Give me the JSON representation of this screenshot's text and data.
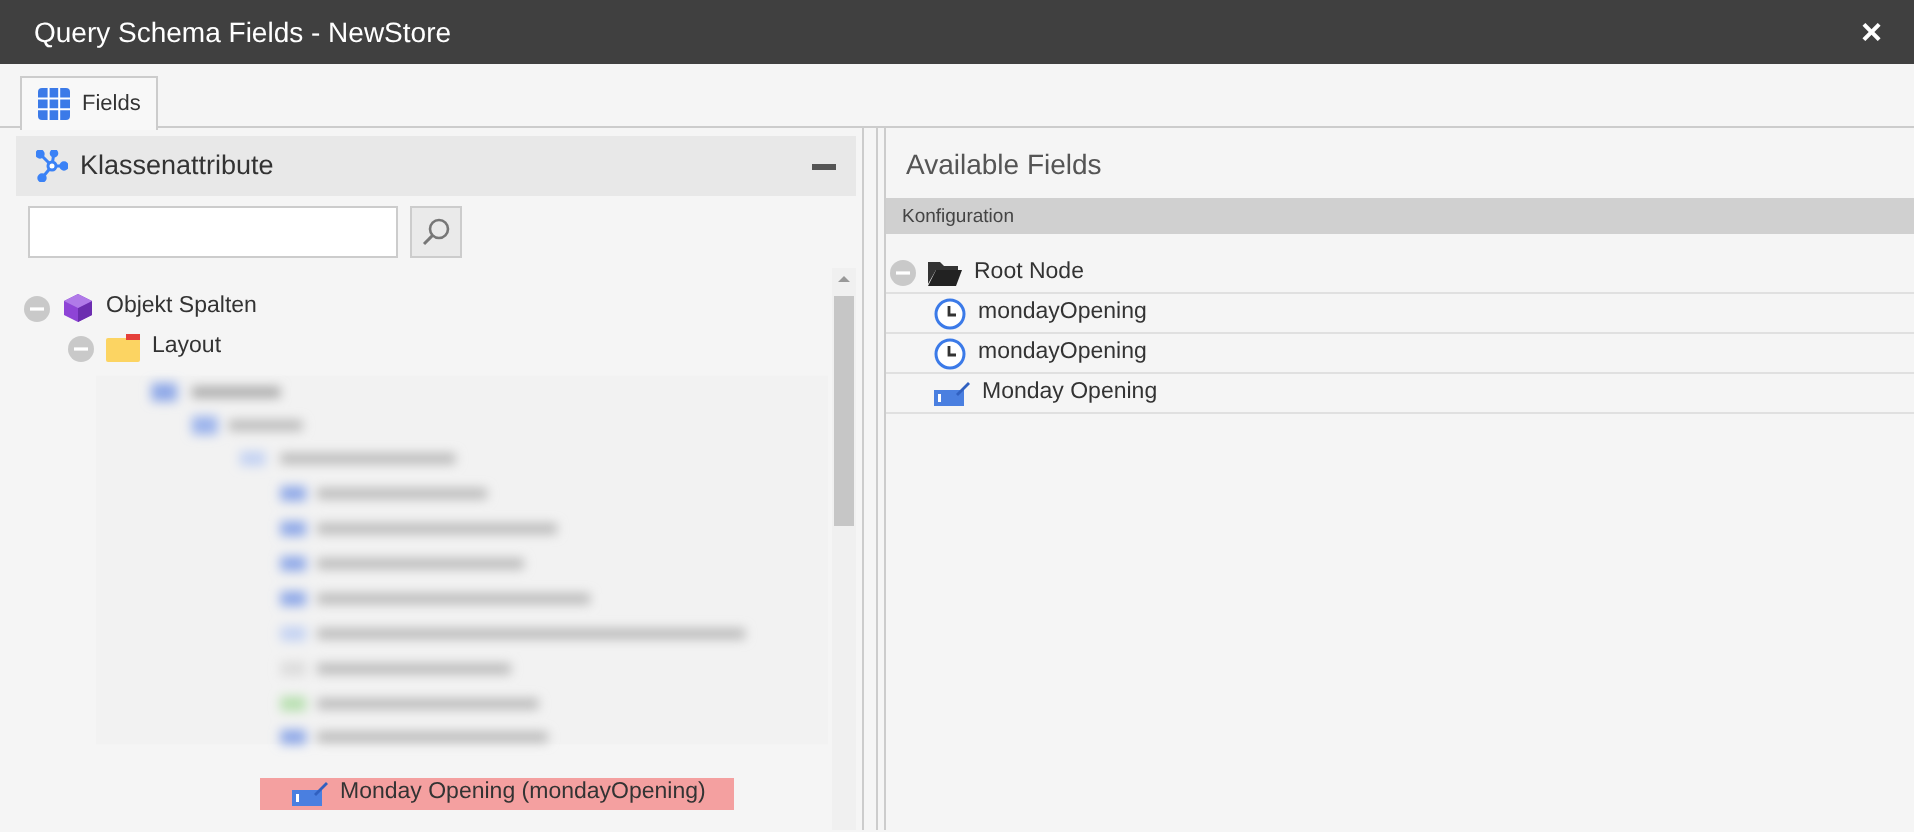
{
  "window": {
    "title": "Query Schema Fields - NewStore",
    "close": "×"
  },
  "tabs": [
    {
      "label": "Fields",
      "selected": true
    }
  ],
  "left_panel": {
    "title": "Klassenattribute",
    "tree": [
      {
        "label": "Objekt Spalten",
        "kind": "object",
        "expanded": true,
        "children": [
          {
            "label": "Layout",
            "kind": "layout",
            "expanded": true
          }
        ]
      }
    ],
    "dragged_item": {
      "label": "Monday Opening (mondayOpening)",
      "kind": "input"
    }
  },
  "right_panel": {
    "title": "Available Fields",
    "section": "Konfiguration",
    "tree": [
      {
        "label": "Root Node",
        "kind": "folder",
        "expanded": true,
        "children": [
          {
            "label": "mondayOpening",
            "kind": "time"
          },
          {
            "label": "mondayOpening",
            "kind": "time"
          },
          {
            "label": "Monday Opening",
            "kind": "input"
          }
        ]
      }
    ]
  }
}
